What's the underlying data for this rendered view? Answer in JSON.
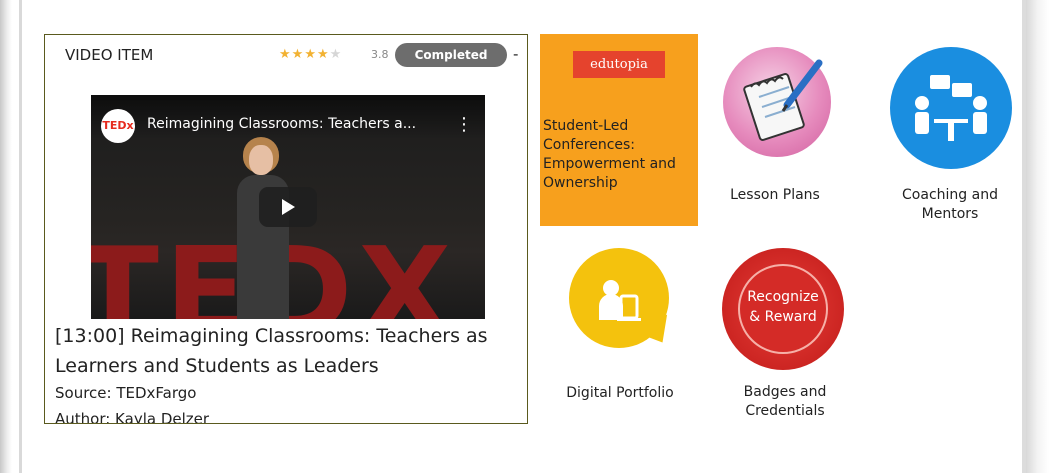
{
  "video_card": {
    "item_type": "VIDEO ITEM",
    "rating": {
      "stars_filled": 4,
      "stars_total": 5,
      "value": "3.8"
    },
    "status": "Completed",
    "trailing_text": "-",
    "player": {
      "channel_logo": "TEDx",
      "title": "Reimagining Classrooms: Teachers a...",
      "stage_text": "TEDX",
      "icons": [
        "menu-kebab-icon",
        "play-icon"
      ]
    },
    "title": "[13:00] Reimagining Classrooms: Teachers as Learners and Students as Leaders",
    "source": "Source: TEDxFargo",
    "author": "Author: Kayla Delzer"
  },
  "tiles": {
    "edutopia": {
      "logo": "edutopia",
      "label": "Student-Led Conferences: Empowerment and Ownership",
      "color": "#f7a01d"
    },
    "lesson_plans": {
      "label": "Lesson Plans",
      "icon": "notepad-pencil-icon"
    },
    "coaching": {
      "label": "Coaching and Mentors",
      "icon": "meeting-people-icon"
    },
    "portfolio": {
      "label": "Digital Portfolio",
      "icon": "portfolio-person-icon"
    },
    "badges": {
      "label": "Badges and Credentials",
      "badge_line1": "Recognize",
      "badge_line2": "& Reward",
      "icon": "seal-badge-icon"
    }
  },
  "colors": {
    "status_pill": "#6d6d6d",
    "star": "#f2b233",
    "coach_blue": "#1a8ee0",
    "portfolio_yellow": "#f4c20d",
    "badge_red": "#cc2522"
  }
}
